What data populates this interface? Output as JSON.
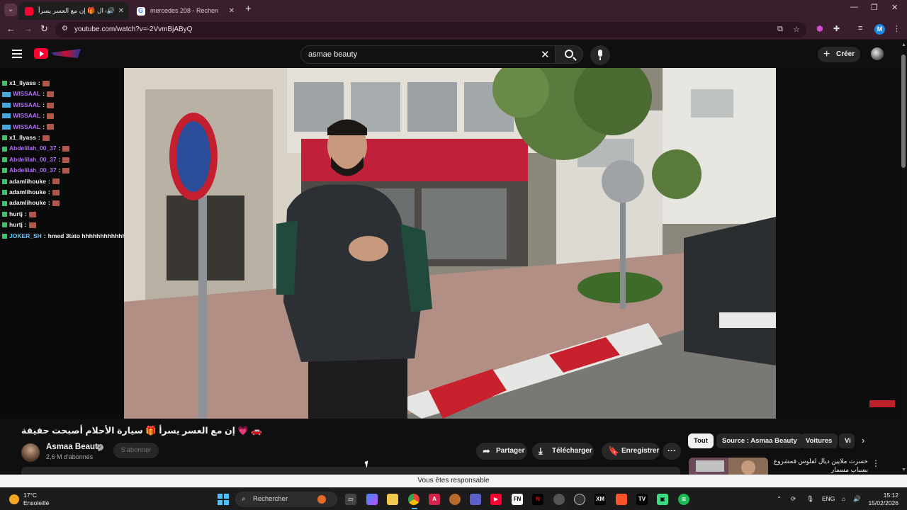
{
  "browser": {
    "tabs": [
      {
        "title": "سيارة ال 🎁 إن مع العسر يسرأ",
        "active": true,
        "favicon": "youtube-icon",
        "audio": true
      },
      {
        "title": "mercedes 208 - Recherche Goo",
        "active": false,
        "favicon": "google-icon"
      }
    ],
    "url": "youtube.com/watch?v=-2VvmBjAByQ",
    "profile_initial": "M",
    "accent_color": "#3a1e2d"
  },
  "youtube": {
    "search_query": "asmae beauty",
    "create_label": "Créer",
    "chat": [
      {
        "user": "x1_llyass",
        "sep": ":",
        "msg": "",
        "color": "white",
        "badge": "mod"
      },
      {
        "user": "WISSAAL",
        "sep": ":",
        "msg": "",
        "color": "purple",
        "badge": "mod-sub"
      },
      {
        "user": "WISSAAL",
        "sep": ":",
        "msg": "",
        "color": "purple",
        "badge": "mod-sub"
      },
      {
        "user": "WISSAAL",
        "sep": ":",
        "msg": "",
        "color": "purple",
        "badge": "mod-sub"
      },
      {
        "user": "WISSAAL",
        "sep": ":",
        "msg": "",
        "color": "purple",
        "badge": "mod-sub"
      },
      {
        "user": "x1_llyass",
        "sep": ":",
        "msg": "",
        "color": "white",
        "badge": "mod"
      },
      {
        "user": "Abdelilah_00_37",
        "sep": ":",
        "msg": "",
        "color": "purple",
        "badge": "mod"
      },
      {
        "user": "Abdelilah_00_37",
        "sep": ":",
        "msg": "",
        "color": "purple",
        "badge": "mod"
      },
      {
        "user": "Abdelilah_00_37",
        "sep": ":",
        "msg": "",
        "color": "purple",
        "badge": "mod"
      },
      {
        "user": "adamlihouke",
        "sep": ":",
        "msg": "",
        "color": "white",
        "badge": "mod-crown"
      },
      {
        "user": "adamlihouke",
        "sep": ":",
        "msg": "",
        "color": "white",
        "badge": "mod-crown"
      },
      {
        "user": "adamlihouke",
        "sep": ":",
        "msg": "",
        "color": "white",
        "badge": "mod-crown"
      },
      {
        "user": "hurtj",
        "sep": ":",
        "msg": "",
        "color": "white",
        "badge": "mod"
      },
      {
        "user": "hurtj",
        "sep": ":",
        "msg": "",
        "color": "white",
        "badge": "mod"
      },
      {
        "user": "JOKER_SH",
        "sep": ":",
        "msg": "hmed 3tato hhhhhhhhhhhh",
        "color": "cyan",
        "badge": "mod"
      }
    ],
    "video": {
      "title": "🚗 💗 إن مع العسر يسرأ 🎁 سيارة الأحلام أصبحت حقيقة",
      "channel": "Asmaa Beauty",
      "subscribers": "2,6 M d'abonnés",
      "subscribe_label": "S'abonner",
      "actions": {
        "share": "Partager",
        "download": "Télécharger",
        "save": "Enregistrer",
        "more": "···"
      }
    },
    "chips": [
      {
        "label": "Tout",
        "active": true
      },
      {
        "label": "Source : Asmaa Beauty",
        "active": false
      },
      {
        "label": "Voitures",
        "active": false
      },
      {
        "label": "Vi",
        "active": false
      }
    ],
    "recommendation": {
      "title": "خسرت ملايين ديال لفلوس فمشروع بسباب مسمار"
    },
    "notice": "Vous êtes responsable"
  },
  "taskbar": {
    "weather_temp": "17°C",
    "weather_desc": "Ensoleillé",
    "search_label": "Rechercher",
    "language": "ENG",
    "time": "15:12",
    "date": "15/02/2026"
  }
}
